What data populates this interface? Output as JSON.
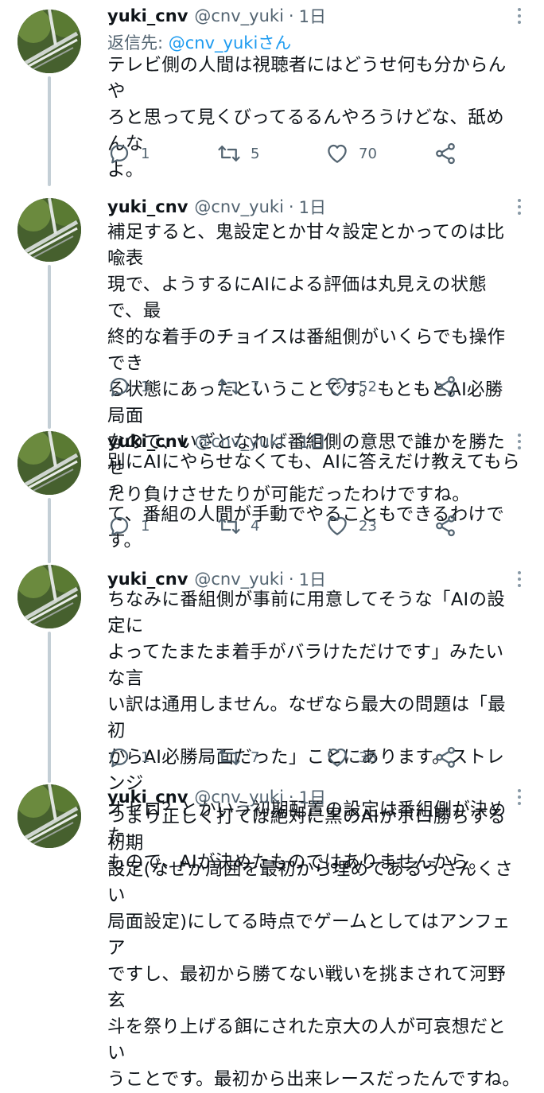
{
  "colors": {
    "text": "#0f1419",
    "muted": "#536471",
    "link": "#1d9bf0",
    "thread_line": "#c4cfd6"
  },
  "tweets": [
    {
      "name": "yuki_cnv",
      "handle": "@cnv_yuki",
      "separator": "·",
      "time": "1日",
      "reply_prefix": "返信先: ",
      "reply_mention": "@cnv_yuki",
      "reply_suffix": "さん",
      "text": "テレビ側の人間は視聴者にはどうせ何も分からんや\nろと思って見くびってるるんやろうけどな、舐めんな\nよ。",
      "replies": "1",
      "retweets": "5",
      "likes": "70"
    },
    {
      "name": "yuki_cnv",
      "handle": "@cnv_yuki",
      "separator": "·",
      "time": "1日",
      "text": "補足すると、鬼設定とか甘々設定とかってのは比喩表\n現で、ようするにAIによる評価は丸見えの状態で、最\n終的な着手のチョイスは番組側がいくらでも操作でき\nる状態にあったということです。もともとAI必勝局面\nなので、いざとなれば番組側の意思で誰かを勝たせ\nたり負けさせたりが可能だったわけですね。",
      "replies": "1",
      "retweets": "7",
      "likes": "52"
    },
    {
      "name": "yuki_cnv",
      "handle": "@cnv_yuki",
      "separator": "·",
      "time": "1日",
      "text": "別にAIにやらせなくても、AIに答えだけ教えてもらっ\nて、番組の人間が手動でやることもできるわけです。",
      "replies": "1",
      "retweets": "4",
      "likes": "23"
    },
    {
      "name": "yuki_cnv",
      "handle": "@cnv_yuki",
      "separator": "·",
      "time": "1日",
      "text": "ちなみに番組側が事前に用意してそうな「AIの設定に\nよってたまたま着手がバラけただけです」みたいな言\nい訳は通用しません。なぜなら最大の問題は「最初\nからAI必勝局面だった」ことにあります。ストレンジ\nオセロ？とかいう初期配置の設定は番組側が決めた\nもので、AIが決めたものではありませんから。",
      "replies": "1",
      "retweets": "7",
      "likes": "38"
    },
    {
      "name": "yuki_cnv",
      "handle": "@cnv_yuki",
      "separator": "·",
      "time": "1日",
      "text": "つまり正しく打てば絶対に黒のAIがボロ勝ちする初期\n設定(なぜか周囲を最初から埋めてあるうさんくさい\n局面設定)にしてる時点でゲームとしてはアンフェア\nですし、最初から勝てない戦いを挑まされて河野玄\n斗を祭り上げる餌にされた京大の人が可哀想だとい\nうことです。最初から出来レースだったんですね。"
    }
  ]
}
